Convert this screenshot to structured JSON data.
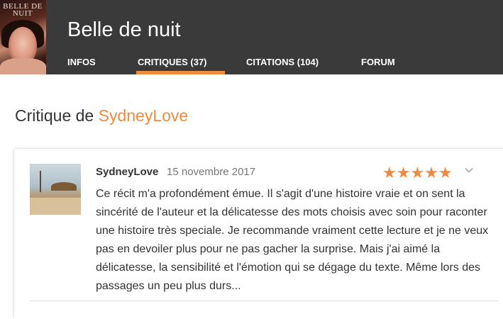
{
  "book": {
    "cover_title": "BELLE DE NUIT",
    "title": "Belle de nuit"
  },
  "tabs": [
    {
      "label": "INFOS",
      "active": false
    },
    {
      "label": "CRITIQUES (37)",
      "active": true
    },
    {
      "label": "CITATIONS (104)",
      "active": false
    },
    {
      "label": "FORUM",
      "active": false
    }
  ],
  "heading": {
    "prefix": "Critique de ",
    "author": "SydneyLove"
  },
  "review": {
    "username": "SydneyLove",
    "date": "15 novembre 2017",
    "stars": "★★★★★",
    "rating": 5,
    "rating_max": 5,
    "text": "Ce récit m'a profondément émue. Il s'agit d'une histoire vraie et on sent la sincérité de l'auteur et la délicatesse des mots choisis avec soin pour raconter une histoire très speciale. Je recommande vraiment cette lecture et je ne veux pas en devoiler plus pour ne pas gacher la surprise. Mais j'ai aimé la délicatesse, la sensibilité et l'émotion qui se dégage du texte. Même lors des passages un peu plus durs..."
  },
  "colors": {
    "accent": "#f08a3c",
    "header_bg": "#3a3a3a",
    "text": "#333333",
    "muted": "#777777"
  },
  "icons": {
    "chevron": "chevron-down-icon",
    "star": "star-icon"
  }
}
